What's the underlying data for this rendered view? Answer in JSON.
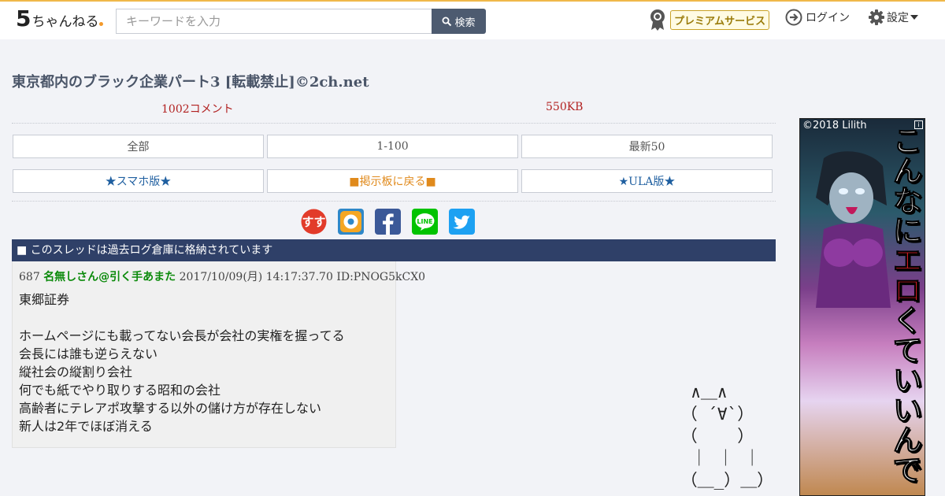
{
  "header": {
    "logo_text": "5ちゃんねる",
    "search_placeholder": "キーワードを入力",
    "search_button": "検索",
    "premium_label": "プレミアムサービス",
    "login_label": "ログイン",
    "settings_label": "設定"
  },
  "thread": {
    "title": "東京都内のブラック企業パート3 [転載禁止]©2ch.net",
    "comment_count": "1002コメント",
    "size": "550KB"
  },
  "nav_buttons": [
    "全部",
    "1-100",
    "最新50"
  ],
  "link_buttons": [
    "★スマホ版★",
    "■掲示板に戻る■",
    "★ULA版★"
  ],
  "share_icons": [
    "matome-icon",
    "app-icon",
    "facebook-icon",
    "line-icon",
    "twitter-icon"
  ],
  "notice": "■ このスレッドは過去ログ倉庫に格納されています",
  "post": {
    "number": "687",
    "name": "名無しさん@引く手あまた",
    "date": "2017/10/09(月) 14:17:37.70",
    "id": "ID:PNOG5kCX0",
    "lines": [
      "東郷証券",
      "",
      "ホームページにも載ってない会長が会社の実権を握ってる",
      "会長には誰も逆らえない",
      "縦社会の縦割り会社",
      "何でも紙でやり取りする昭和の会社",
      "高齢者にテレアポ攻撃する以外の儲け方が存在しない",
      "新人は2年でほぼ消える"
    ]
  },
  "ascii_art": "  ∧＿∧\n （ ´∀`）\n （    ）\n  ｜ ｜ ｜\n （＿_）＿）",
  "ad": {
    "copyright": "©2018 Lilith",
    "info": "i",
    "text_1": "こんなに",
    "text_red": "エロ",
    "text_2": "くて",
    "text_3": "いいんで"
  },
  "colors": {
    "accent_top": "#f0b84a",
    "notice_bg": "#2f4068",
    "title": "#4a5568",
    "meta": "#b22222",
    "post_name": "#0b8a0b"
  }
}
